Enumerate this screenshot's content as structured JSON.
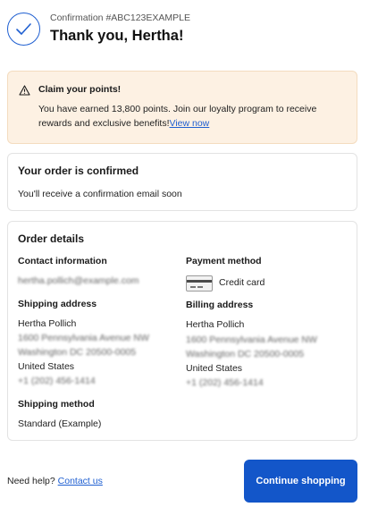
{
  "header": {
    "confirmation": "Confirmation #ABC123EXAMPLE",
    "title": "Thank you, Hertha!"
  },
  "points_banner": {
    "icon": "warning-icon",
    "title": "Claim your points!",
    "body": "You have earned 13,800 points. Join our loyalty program to receive rewards and exclusive benefits!",
    "link": "View now",
    "colors": {
      "background": "#fdf1e3",
      "border": "#f4dcbf"
    }
  },
  "order_confirmed": {
    "title": "Your order is confirmed",
    "subtitle": "You'll receive a confirmation email soon"
  },
  "order_details": {
    "title": "Order details",
    "contact": {
      "label": "Contact information",
      "value": "hertha.pollich@example.com"
    },
    "payment": {
      "label": "Payment method",
      "value": "Credit card",
      "icon": "credit-card-icon"
    },
    "shipping_address": {
      "label": "Shipping address",
      "name": "Hertha Pollich",
      "street": "1600 Pennsylvania Avenue NW",
      "city": "Washington DC 20500-0005",
      "country": "United States",
      "phone": "+1 (202) 456-1414"
    },
    "billing_address": {
      "label": "Billing address",
      "name": "Hertha Pollich",
      "street": "1600 Pennsylvania Avenue NW",
      "city": "Washington DC 20500-0005",
      "country": "United States",
      "phone": "+1 (202) 456-1414"
    },
    "shipping_method": {
      "label": "Shipping method",
      "value": "Standard (Example)"
    }
  },
  "footer": {
    "help_text": "Need help?",
    "help_link": "Contact us",
    "continue_label": "Continue shopping"
  },
  "colors": {
    "accent": "#1356c9",
    "link": "#1f5fd1"
  }
}
